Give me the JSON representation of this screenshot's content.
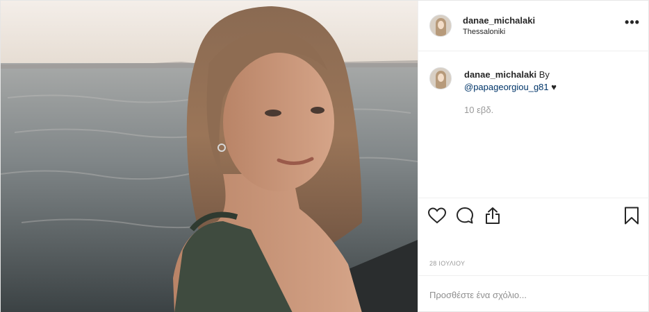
{
  "post": {
    "author": {
      "username": "danae_michalaki",
      "location": "Thessaloniki"
    },
    "options_label": "•••",
    "caption": {
      "username": "danae_michalaki",
      "text": "By",
      "mention": "@papageorgiou_g81",
      "emoji": "♥"
    },
    "time_ago": "10 εβδ.",
    "date": "28 ΙΟΥΛΙΟΥ",
    "comment_placeholder": "Προσθέστε ένα σχόλιο..."
  },
  "icons": {
    "like": "heart-icon",
    "comment": "comment-icon",
    "share": "share-icon",
    "save": "bookmark-icon",
    "options": "ellipsis-icon"
  },
  "colors": {
    "text": "#262626",
    "secondary": "#999999",
    "mention": "#003569",
    "border": "#efefef"
  }
}
